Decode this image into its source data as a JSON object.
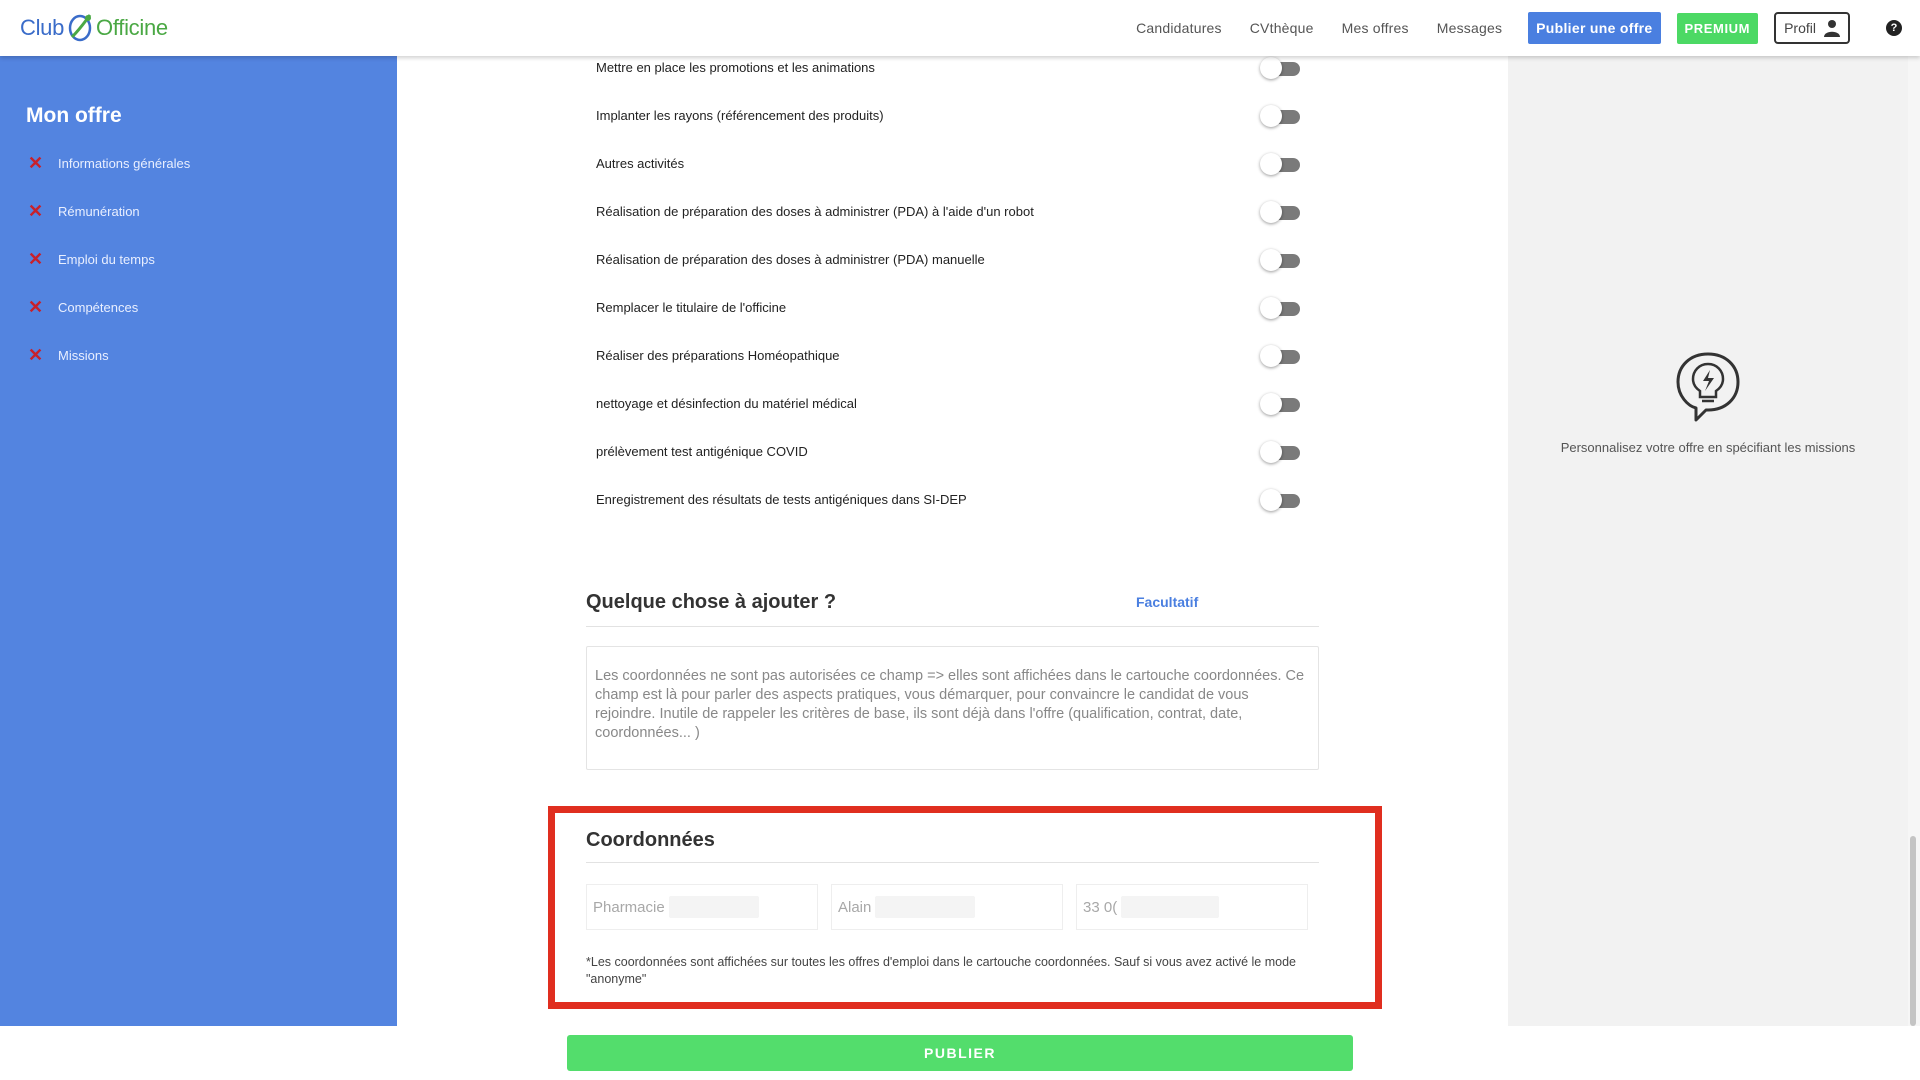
{
  "header": {
    "logo": {
      "part1": "Club",
      "part2": "Officine"
    },
    "nav": [
      "Candidatures",
      "CVthèque",
      "Mes offres",
      "Messages"
    ],
    "publish_label": "Publier une offre",
    "premium_label": "PREMIUM",
    "profil_label": "Profil",
    "help_label": "?"
  },
  "sidebar": {
    "title": "Mon offre",
    "items": [
      {
        "label": "Informations générales"
      },
      {
        "label": "Rémunération"
      },
      {
        "label": "Emploi du temps"
      },
      {
        "label": "Compétences"
      },
      {
        "label": "Missions"
      }
    ]
  },
  "missions": [
    {
      "label": "Mettre en place les promotions et les animations",
      "enabled": false
    },
    {
      "label": "Implanter les rayons (référencement des produits)",
      "enabled": false
    },
    {
      "label": "Autres activités",
      "enabled": false
    },
    {
      "label": "Réalisation de préparation des doses à administrer (PDA) à l'aide d'un robot",
      "enabled": false
    },
    {
      "label": "Réalisation de préparation des doses à administrer (PDA) manuelle",
      "enabled": false
    },
    {
      "label": "Remplacer le titulaire de l'officine",
      "enabled": false
    },
    {
      "label": "Réaliser des préparations Homéopathique",
      "enabled": false
    },
    {
      "label": "nettoyage et désinfection du matériel médical",
      "enabled": false
    },
    {
      "label": "prélèvement test antigénique COVID",
      "enabled": false
    },
    {
      "label": "Enregistrement des résultats de tests antigéniques dans SI-DEP",
      "enabled": false
    }
  ],
  "extra": {
    "title": "Quelque chose à ajouter ?",
    "optional_label": "Facultatif",
    "placeholder": "Les coordonnées ne sont pas autorisées ce champ => elles sont affichées dans le cartouche coordonnées. Ce champ est là pour parler des aspects pratiques, vous démarquer, pour convaincre le candidat de vous rejoindre. Inutile de rappeler les critères de base, ils sont déjà dans l'offre (qualification, contrat, date, coordonnées... )"
  },
  "coordinates": {
    "title": "Coordonnées",
    "fields": [
      {
        "value": "Pharmacie"
      },
      {
        "value": "Alain"
      },
      {
        "value": "33 0("
      }
    ],
    "note": "*Les coordonnées sont affichées sur toutes les offres d'emploi dans le cartouche coordonnées. Sauf si vous avez activé le mode \"anonyme\""
  },
  "right_panel": {
    "tip": "Personnalisez votre offre en spécifiant les missions"
  },
  "footer": {
    "publish_label": "PUBLIER"
  },
  "colors": {
    "primary": "#4a7fe0",
    "sidebar": "#5384e0",
    "success": "#53dd6c",
    "danger": "#c8202a",
    "highlight": "#e02e1f"
  }
}
